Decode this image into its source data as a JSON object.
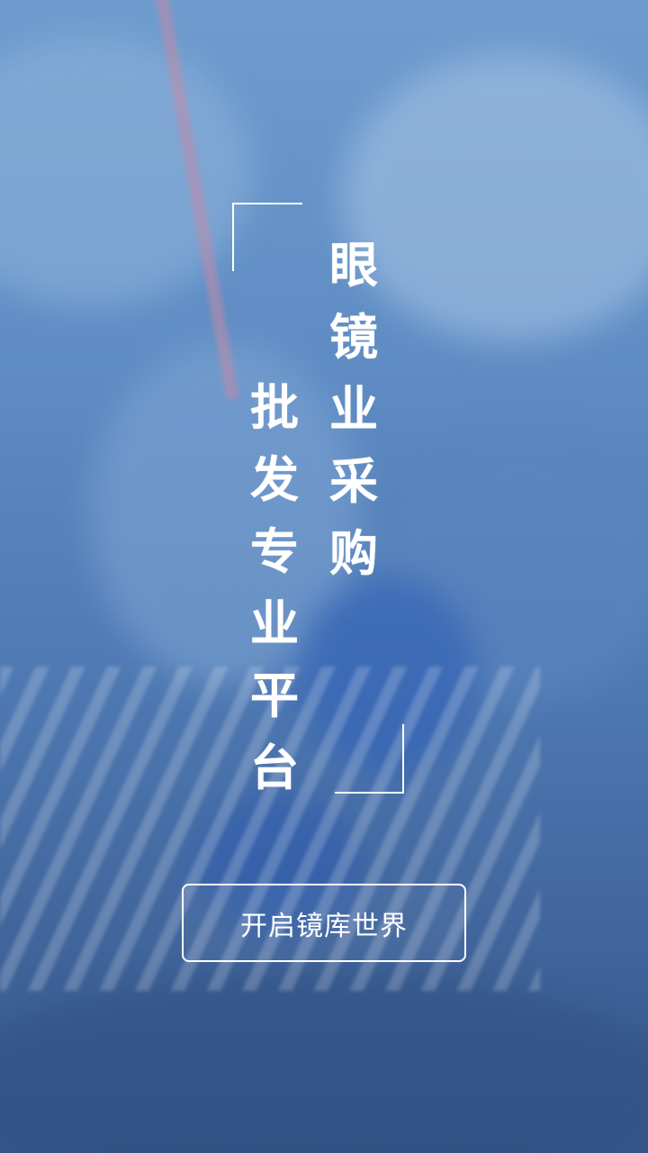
{
  "splash": {
    "headline_right": [
      "眼",
      "镜",
      "业",
      "采",
      "购"
    ],
    "headline_left": [
      "批",
      "发",
      "专",
      "业",
      "平",
      "台"
    ],
    "enter_button_label": "开启镜库世界"
  },
  "colors": {
    "background_top": "#6e9cce",
    "background_bottom": "#35578b",
    "text": "#ffffff",
    "frame_lines": "#ffffff"
  }
}
